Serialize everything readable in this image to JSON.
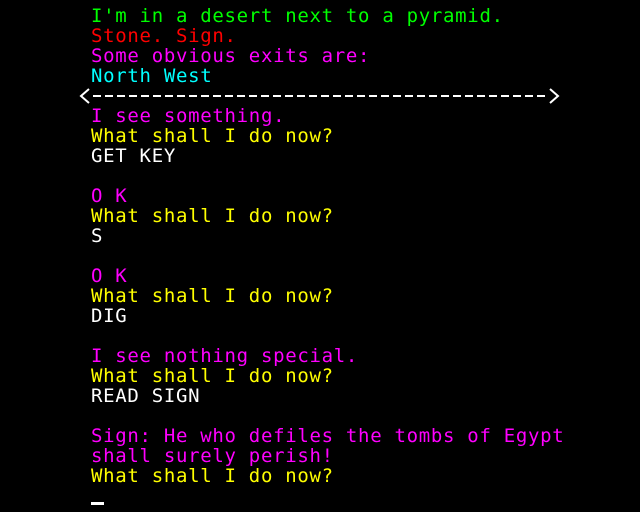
{
  "room": {
    "description": "I'm in a desert next to a pyramid.",
    "items": "Stone. Sign.",
    "exits_heading": "Some obvious exits are:",
    "exits": "North West"
  },
  "transcript": [
    {
      "response": "I see something.",
      "prompt": "What shall I do now?",
      "command": "GET KEY"
    },
    {
      "response": "O K",
      "prompt": "What shall I do now?",
      "command": "S"
    },
    {
      "response": "O K",
      "prompt": "What shall I do now?",
      "command": "DIG"
    },
    {
      "response": "I see nothing special.",
      "prompt": "What shall I do now?",
      "command": "READ SIGN"
    }
  ],
  "last": {
    "response_line1": "Sign: He who defiles the tombs of Egypt",
    "response_line2": "shall surely perish!",
    "prompt": "What shall I do now?"
  },
  "colors": {
    "background": "#000000",
    "room_description": "#00ff00",
    "items": "#ff0000",
    "system_text": "#ff00ff",
    "exits": "#00ffff",
    "prompt": "#ffff00",
    "player_input": "#ffffff"
  }
}
